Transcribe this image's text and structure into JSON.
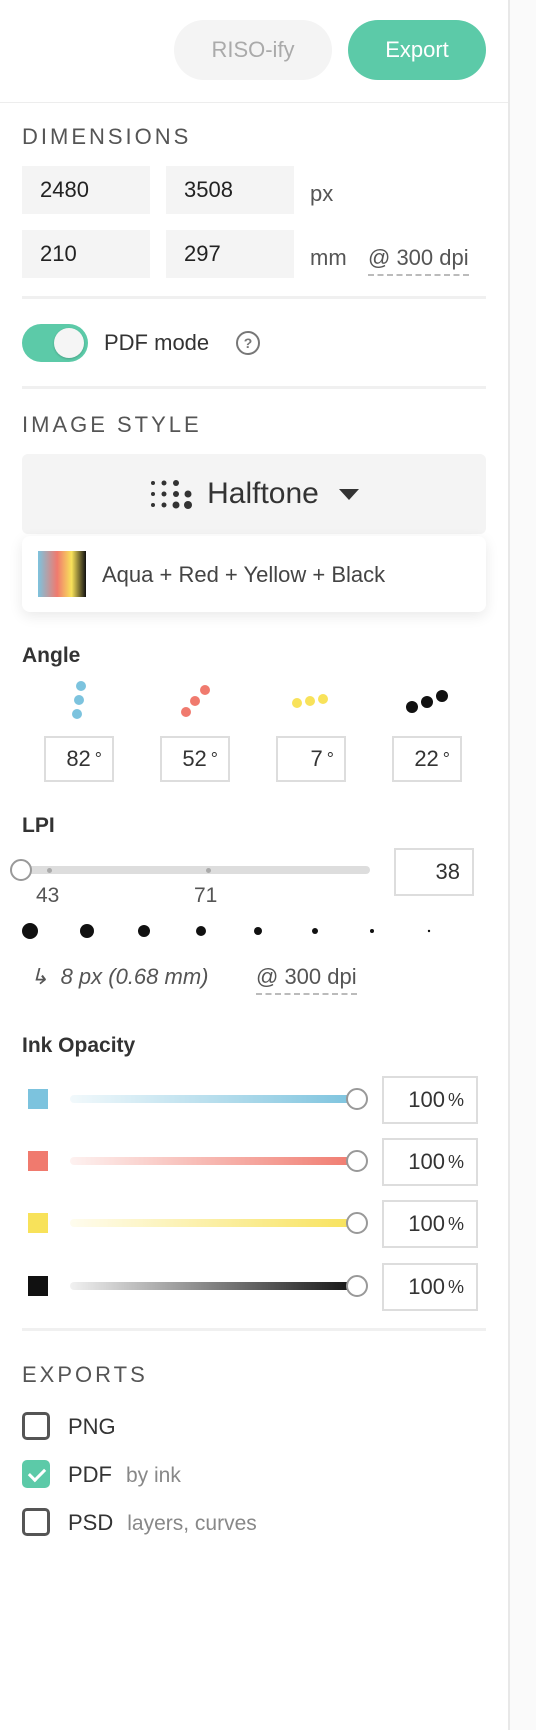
{
  "toolbar": {
    "rify_label": "RISO-ify",
    "export_label": "Export"
  },
  "dimensions": {
    "title": "DIMENSIONS",
    "width_px": "2480",
    "height_px": "3508",
    "px_unit": "px",
    "width_mm": "210",
    "height_mm": "297",
    "mm_unit": "mm",
    "dpi_label": "@ 300 dpi"
  },
  "pdf_mode": {
    "label": "PDF mode",
    "enabled": true,
    "help_glyph": "?"
  },
  "image_style": {
    "title": "IMAGE STYLE",
    "selected": "Halftone",
    "palette_label": "Aqua + Red + Yellow + Black"
  },
  "angle": {
    "title": "Angle",
    "values": [
      {
        "value": "82",
        "unit": "°",
        "color": "#7cc3de"
      },
      {
        "value": "52",
        "unit": "°",
        "color": "#f07a6e"
      },
      {
        "value": "7",
        "unit": "°",
        "color": "#f8e25a"
      },
      {
        "value": "22",
        "unit": "°",
        "color": "#111111"
      }
    ]
  },
  "lpi": {
    "title": "LPI",
    "value": "38",
    "tick_labels": [
      "43",
      "71"
    ],
    "dot_size_text": "8 px (0.68 mm)",
    "dpi_label": "@ 300 dpi",
    "arrow_glyph": "↳"
  },
  "ink_opacity": {
    "title": "Ink Opacity",
    "inks": [
      {
        "name": "aqua",
        "color": "#7cc3de",
        "value": "100",
        "unit": "%"
      },
      {
        "name": "red",
        "color": "#f07a6e",
        "value": "100",
        "unit": "%"
      },
      {
        "name": "yellow",
        "color": "#f8e25a",
        "value": "100",
        "unit": "%"
      },
      {
        "name": "black",
        "color": "#111111",
        "value": "100",
        "unit": "%"
      }
    ]
  },
  "exports": {
    "title": "EXPORTS",
    "items": [
      {
        "label": "PNG",
        "sub": "",
        "checked": false
      },
      {
        "label": "PDF",
        "sub": "by ink",
        "checked": true
      },
      {
        "label": "PSD",
        "sub": "layers, curves",
        "checked": false
      }
    ]
  },
  "colors": {
    "accent": "#5ccaa8",
    "aqua": "#7cc3de",
    "red": "#f07a6e",
    "yellow": "#f8e25a",
    "black": "#111111"
  }
}
